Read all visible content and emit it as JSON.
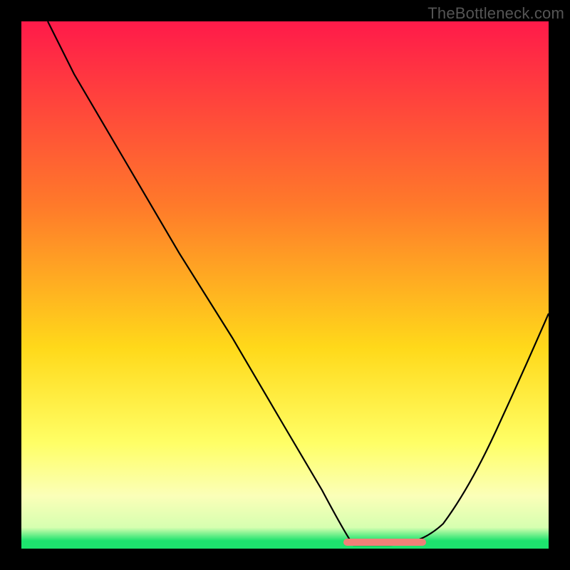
{
  "watermark": "TheBottleneck.com",
  "colors": {
    "top": "#ff1a4a",
    "mid_upper": "#ff7a2a",
    "mid": "#ffd91a",
    "lower": "#ffff66",
    "pale": "#fbffb8",
    "green": "#1de36e",
    "trough": "#f08078",
    "curve": "#000000",
    "frame": "#000000"
  },
  "chart_data": {
    "type": "line",
    "title": "",
    "xlabel": "",
    "ylabel": "",
    "xlim": [
      0,
      100
    ],
    "ylim": [
      0,
      100
    ],
    "curve": {
      "x": [
        5,
        10,
        20,
        30,
        40,
        50,
        57,
        63,
        70,
        76,
        80,
        85,
        90,
        95,
        100
      ],
      "y": [
        100,
        90,
        73,
        56,
        40,
        23,
        11,
        3,
        0,
        0,
        4,
        12,
        22,
        33,
        45
      ]
    },
    "trough_region": {
      "x_start": 63,
      "x_end": 77,
      "y": 0
    },
    "gradient_stops": [
      {
        "pos": 0.0,
        "color": "#ff1a4a"
      },
      {
        "pos": 0.35,
        "color": "#ff7a2a"
      },
      {
        "pos": 0.62,
        "color": "#ffd91a"
      },
      {
        "pos": 0.8,
        "color": "#ffff66"
      },
      {
        "pos": 0.9,
        "color": "#fbffb8"
      },
      {
        "pos": 0.985,
        "color": "#1de36e"
      }
    ]
  }
}
